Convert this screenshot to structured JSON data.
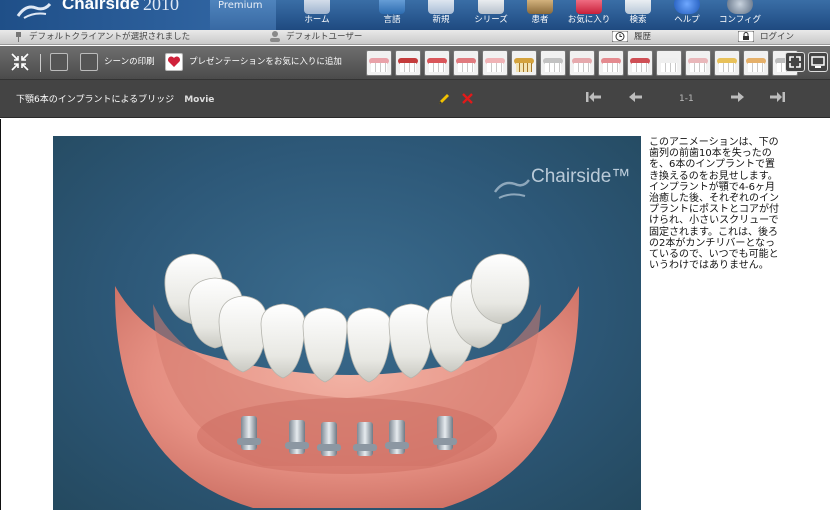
{
  "app": {
    "brand": "Chairside",
    "trademark": "®",
    "year": "2010",
    "edition": "Premium"
  },
  "nav": [
    {
      "label": "ホーム",
      "icon": "tooth-home-icon"
    },
    {
      "label": "言語",
      "icon": "language-icon"
    },
    {
      "label": "新規",
      "icon": "new-icon"
    },
    {
      "label": "シリーズ",
      "icon": "series-icon"
    },
    {
      "label": "患者",
      "icon": "patient-icon"
    },
    {
      "label": "お気に入り",
      "icon": "favorites-icon"
    },
    {
      "label": "検索",
      "icon": "search-icon"
    },
    {
      "label": "ヘルプ",
      "icon": "help-icon"
    },
    {
      "label": "コンフィグ",
      "icon": "config-icon"
    }
  ],
  "userbar": {
    "client": "デフォルトクライアントが選択されました",
    "user": "デフォルトユーザー",
    "history": "履歴",
    "login": "ログイン"
  },
  "toolbar": {
    "print_scene": "シーンの印刷",
    "add_favorite": "プレゼンテーションをお気に入りに追加"
  },
  "title": {
    "text": "下顎6本のインプラントによるブリッジ",
    "type": "Movie"
  },
  "pager": {
    "position": "1-1"
  },
  "scene": {
    "watermark": "Chairside™"
  },
  "description": "このアニメーションは、下の歯列の前歯10本を失ったのを、6本のインプラントで置き換えるのをお見せします。インプラントが顎で4-6ヶ月治癒した後、それぞれのインプラントにポストとコアが付けられ、小さいスクリューで固定されます。これは、後ろの2本がカンチリバーとなっているので、いつでも可能というわけではありません。",
  "colors": {
    "topbar": "#2a5a92",
    "toolbar": "#5a5a5a",
    "titlebar": "#444444",
    "scene_bg": "#2d5878",
    "pencil": "#f2c200",
    "delete": "#e01a1a"
  }
}
